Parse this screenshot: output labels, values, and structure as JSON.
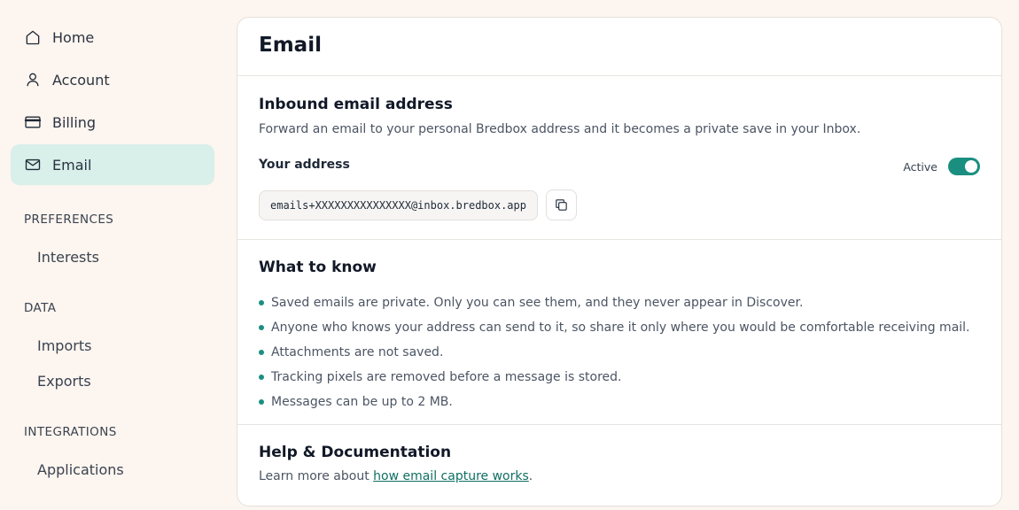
{
  "sidebar": {
    "nav": [
      {
        "label": "Home",
        "icon": "home-icon"
      },
      {
        "label": "Account",
        "icon": "user-icon"
      },
      {
        "label": "Billing",
        "icon": "credit-card-icon"
      },
      {
        "label": "Email",
        "icon": "mail-icon",
        "active": true
      }
    ],
    "preferences_label": "PREFERENCES",
    "preferences_items": [
      "Interests"
    ],
    "data_label": "DATA",
    "data_items": [
      "Imports",
      "Exports"
    ],
    "integrations_label": "INTEGRATIONS",
    "integrations_items": [
      "Applications"
    ]
  },
  "main": {
    "title": "Email",
    "inbound": {
      "title": "Inbound email address",
      "description": "Forward an email to your personal Bredbox address and it becomes a private save in your Inbox.",
      "address_label": "Your address",
      "status_label": "Active",
      "active": true,
      "address": "emails+XXXXXXXXXXXXXXX@inbox.bredbox.app",
      "copy_icon": "copy-icon"
    },
    "what_to_know": {
      "title": "What to know",
      "items": [
        "Saved emails are private. Only you can see them, and they never appear in Discover.",
        "Anyone who knows your address can send to it, so share it only where you would be comfortable receiving mail.",
        "Attachments are not saved.",
        "Tracking pixels are removed before a message is stored.",
        "Messages can be up to 2 MB."
      ]
    },
    "help": {
      "title": "Help & Documentation",
      "text_before": "Learn more about ",
      "link_text": "how email capture works",
      "text_after": "."
    }
  },
  "colors": {
    "accent": "#1a8f80",
    "active_nav_bg": "#d8efea",
    "page_bg": "#fdf5ef"
  }
}
